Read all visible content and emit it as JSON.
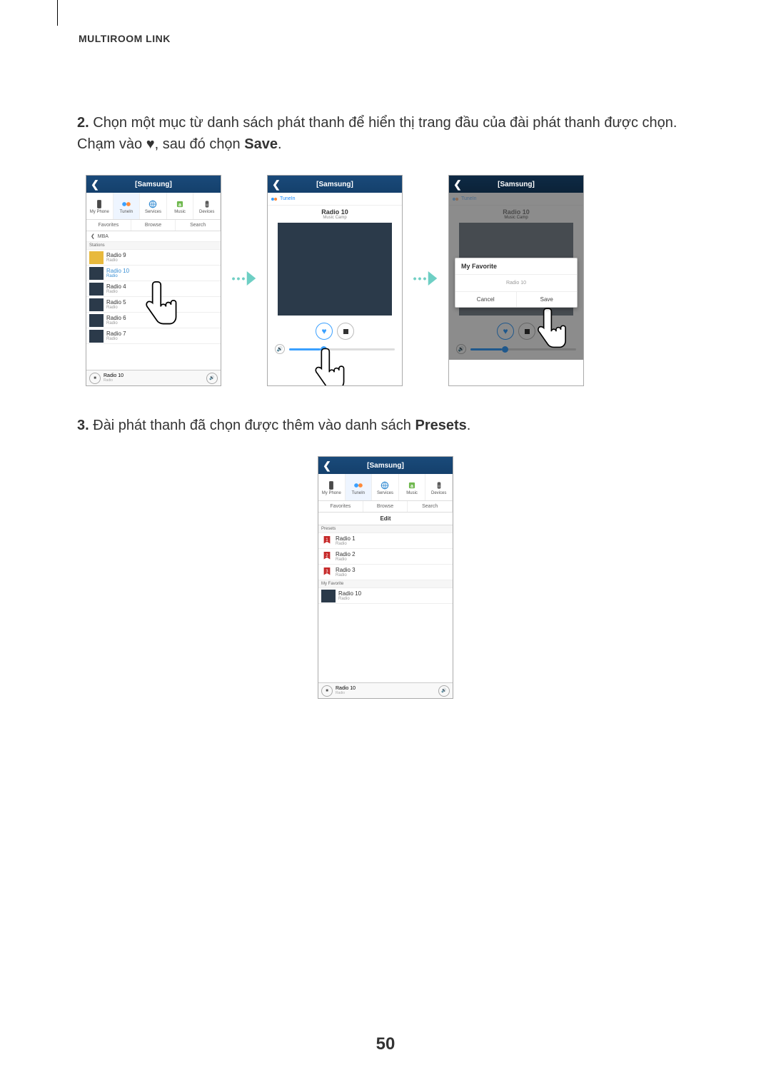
{
  "header": "MULTIROOM LINK",
  "step2": {
    "num": "2.",
    "text": " Chọn một mục từ danh sách phát thanh để hiển thị trang đầu của đài phát thanh được chọn. Chạm vào ",
    "text2": ", sau đó chọn ",
    "bold": "Save",
    "tail": "."
  },
  "step3": {
    "num": "3.",
    "text": " Đài phát thanh đã chọn được thêm vào danh sách ",
    "bold": "Presets",
    "tail": "."
  },
  "shot1": {
    "title": "[Samsung]",
    "icons": [
      "My Phone",
      "TuneIn",
      "Services",
      "Music",
      "Devices"
    ],
    "tabs": [
      "Favorites",
      "Browse",
      "Search"
    ],
    "crumb": "MBA",
    "section": "Stations",
    "stations": [
      {
        "name": "Radio 9",
        "sub": "Radio"
      },
      {
        "name": "Radio 10",
        "sub": "Radio"
      },
      {
        "name": "Radio 4",
        "sub": "Radio"
      },
      {
        "name": "Radio 5",
        "sub": "Radio"
      },
      {
        "name": "Radio 6",
        "sub": "Radio"
      },
      {
        "name": "Radio 7",
        "sub": "Radio"
      }
    ],
    "nowplaying": {
      "name": "Radio 10",
      "sub": "Radio"
    }
  },
  "shot2": {
    "title": "[Samsung]",
    "tunein": "TuneIn",
    "radio": "Radio 10",
    "sub": "Music Camp"
  },
  "shot3": {
    "title": "[Samsung]",
    "tunein": "TuneIn",
    "radio": "Radio 10",
    "sub": "Music Camp",
    "modal": {
      "title": "My Favorite",
      "body": "Radio 10",
      "cancel": "Cancel",
      "save": "Save"
    }
  },
  "shot4": {
    "title": "[Samsung]",
    "icons": [
      "My Phone",
      "TuneIn",
      "Services",
      "Music",
      "Devices"
    ],
    "tabs": [
      "Favorites",
      "Browse",
      "Search"
    ],
    "edit": "Edit",
    "presets_label": "Presets",
    "presets": [
      {
        "name": "Radio 1",
        "sub": "Radio"
      },
      {
        "name": "Radio 2",
        "sub": "Radio"
      },
      {
        "name": "Radio 3",
        "sub": "Radio"
      }
    ],
    "fav_label": "My Favorite",
    "favs": [
      {
        "name": "Radio 10",
        "sub": "Radio"
      }
    ],
    "nowplaying": {
      "name": "Radio 10",
      "sub": "Radio"
    }
  },
  "page_num": "50"
}
